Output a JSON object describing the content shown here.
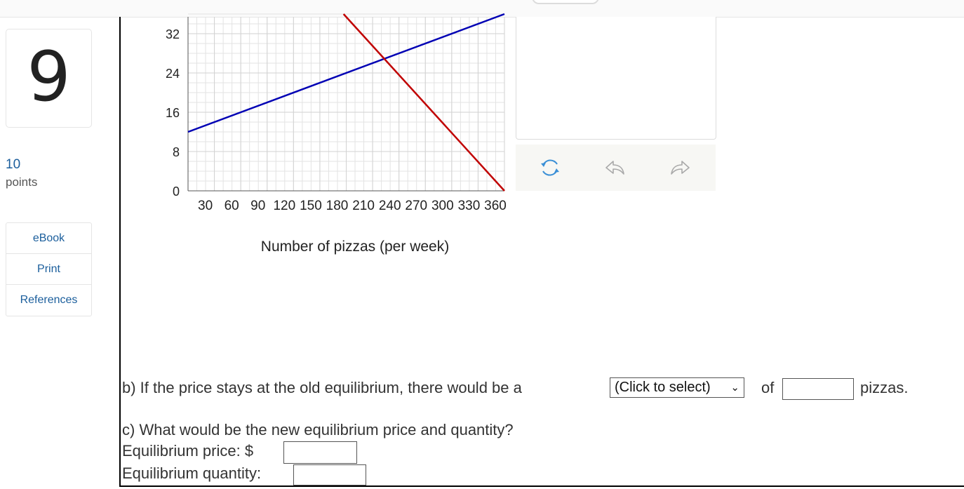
{
  "question": {
    "number": "9",
    "points_value": "10",
    "points_label": "points"
  },
  "resources": [
    "eBook",
    "Print",
    "References"
  ],
  "chart_data": {
    "type": "line",
    "xlabel": "Number of pizzas (per week)",
    "y_tick_labels": [
      "0",
      "8",
      "16",
      "24",
      "32"
    ],
    "x_tick_labels": [
      "30",
      "60",
      "90",
      "120",
      "150",
      "180",
      "210",
      "240",
      "270",
      "300",
      "330",
      "360"
    ],
    "xlim": [
      0,
      360
    ],
    "ylim": [
      0,
      36
    ],
    "grid": true,
    "series": [
      {
        "color": "#0000b4",
        "points": [
          [
            0,
            12
          ],
          [
            360,
            36
          ]
        ]
      },
      {
        "color": "#c00000",
        "points": [
          [
            177,
            36
          ],
          [
            360,
            0
          ]
        ]
      }
    ]
  },
  "toolbar": {
    "icons": [
      "refresh-icon",
      "undo-icon",
      "redo-icon"
    ]
  },
  "part_b": {
    "prefix": "b) If the price stays at the old equilibrium, there would be a",
    "select_value": "(Click to select)",
    "of_label": "of",
    "suffix": "pizzas."
  },
  "part_c": {
    "question": "c) What would be the new equilibrium price and quantity?",
    "price_label": "Equilibrium price: $",
    "quantity_label": "Equilibrium quantity:"
  }
}
